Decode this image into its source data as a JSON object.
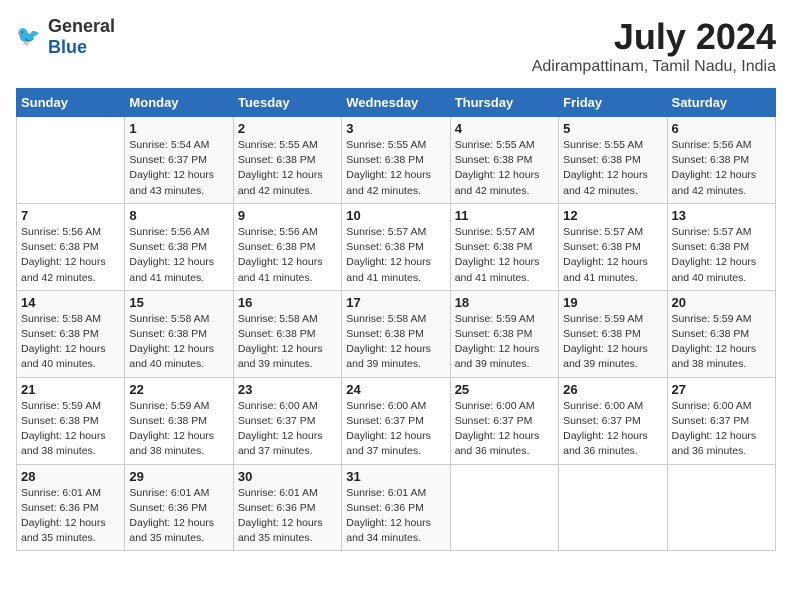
{
  "logo": {
    "general": "General",
    "blue": "Blue"
  },
  "title": "July 2024",
  "subtitle": "Adirampattinam, Tamil Nadu, India",
  "columns": [
    "Sunday",
    "Monday",
    "Tuesday",
    "Wednesday",
    "Thursday",
    "Friday",
    "Saturday"
  ],
  "weeks": [
    [
      {
        "num": "",
        "detail": ""
      },
      {
        "num": "1",
        "detail": "Sunrise: 5:54 AM\nSunset: 6:37 PM\nDaylight: 12 hours\nand 43 minutes."
      },
      {
        "num": "2",
        "detail": "Sunrise: 5:55 AM\nSunset: 6:38 PM\nDaylight: 12 hours\nand 42 minutes."
      },
      {
        "num": "3",
        "detail": "Sunrise: 5:55 AM\nSunset: 6:38 PM\nDaylight: 12 hours\nand 42 minutes."
      },
      {
        "num": "4",
        "detail": "Sunrise: 5:55 AM\nSunset: 6:38 PM\nDaylight: 12 hours\nand 42 minutes."
      },
      {
        "num": "5",
        "detail": "Sunrise: 5:55 AM\nSunset: 6:38 PM\nDaylight: 12 hours\nand 42 minutes."
      },
      {
        "num": "6",
        "detail": "Sunrise: 5:56 AM\nSunset: 6:38 PM\nDaylight: 12 hours\nand 42 minutes."
      }
    ],
    [
      {
        "num": "7",
        "detail": "Sunrise: 5:56 AM\nSunset: 6:38 PM\nDaylight: 12 hours\nand 42 minutes."
      },
      {
        "num": "8",
        "detail": "Sunrise: 5:56 AM\nSunset: 6:38 PM\nDaylight: 12 hours\nand 41 minutes."
      },
      {
        "num": "9",
        "detail": "Sunrise: 5:56 AM\nSunset: 6:38 PM\nDaylight: 12 hours\nand 41 minutes."
      },
      {
        "num": "10",
        "detail": "Sunrise: 5:57 AM\nSunset: 6:38 PM\nDaylight: 12 hours\nand 41 minutes."
      },
      {
        "num": "11",
        "detail": "Sunrise: 5:57 AM\nSunset: 6:38 PM\nDaylight: 12 hours\nand 41 minutes."
      },
      {
        "num": "12",
        "detail": "Sunrise: 5:57 AM\nSunset: 6:38 PM\nDaylight: 12 hours\nand 41 minutes."
      },
      {
        "num": "13",
        "detail": "Sunrise: 5:57 AM\nSunset: 6:38 PM\nDaylight: 12 hours\nand 40 minutes."
      }
    ],
    [
      {
        "num": "14",
        "detail": "Sunrise: 5:58 AM\nSunset: 6:38 PM\nDaylight: 12 hours\nand 40 minutes."
      },
      {
        "num": "15",
        "detail": "Sunrise: 5:58 AM\nSunset: 6:38 PM\nDaylight: 12 hours\nand 40 minutes."
      },
      {
        "num": "16",
        "detail": "Sunrise: 5:58 AM\nSunset: 6:38 PM\nDaylight: 12 hours\nand 39 minutes."
      },
      {
        "num": "17",
        "detail": "Sunrise: 5:58 AM\nSunset: 6:38 PM\nDaylight: 12 hours\nand 39 minutes."
      },
      {
        "num": "18",
        "detail": "Sunrise: 5:59 AM\nSunset: 6:38 PM\nDaylight: 12 hours\nand 39 minutes."
      },
      {
        "num": "19",
        "detail": "Sunrise: 5:59 AM\nSunset: 6:38 PM\nDaylight: 12 hours\nand 39 minutes."
      },
      {
        "num": "20",
        "detail": "Sunrise: 5:59 AM\nSunset: 6:38 PM\nDaylight: 12 hours\nand 38 minutes."
      }
    ],
    [
      {
        "num": "21",
        "detail": "Sunrise: 5:59 AM\nSunset: 6:38 PM\nDaylight: 12 hours\nand 38 minutes."
      },
      {
        "num": "22",
        "detail": "Sunrise: 5:59 AM\nSunset: 6:38 PM\nDaylight: 12 hours\nand 38 minutes."
      },
      {
        "num": "23",
        "detail": "Sunrise: 6:00 AM\nSunset: 6:37 PM\nDaylight: 12 hours\nand 37 minutes."
      },
      {
        "num": "24",
        "detail": "Sunrise: 6:00 AM\nSunset: 6:37 PM\nDaylight: 12 hours\nand 37 minutes."
      },
      {
        "num": "25",
        "detail": "Sunrise: 6:00 AM\nSunset: 6:37 PM\nDaylight: 12 hours\nand 36 minutes."
      },
      {
        "num": "26",
        "detail": "Sunrise: 6:00 AM\nSunset: 6:37 PM\nDaylight: 12 hours\nand 36 minutes."
      },
      {
        "num": "27",
        "detail": "Sunrise: 6:00 AM\nSunset: 6:37 PM\nDaylight: 12 hours\nand 36 minutes."
      }
    ],
    [
      {
        "num": "28",
        "detail": "Sunrise: 6:01 AM\nSunset: 6:36 PM\nDaylight: 12 hours\nand 35 minutes."
      },
      {
        "num": "29",
        "detail": "Sunrise: 6:01 AM\nSunset: 6:36 PM\nDaylight: 12 hours\nand 35 minutes."
      },
      {
        "num": "30",
        "detail": "Sunrise: 6:01 AM\nSunset: 6:36 PM\nDaylight: 12 hours\nand 35 minutes."
      },
      {
        "num": "31",
        "detail": "Sunrise: 6:01 AM\nSunset: 6:36 PM\nDaylight: 12 hours\nand 34 minutes."
      },
      {
        "num": "",
        "detail": ""
      },
      {
        "num": "",
        "detail": ""
      },
      {
        "num": "",
        "detail": ""
      }
    ]
  ]
}
